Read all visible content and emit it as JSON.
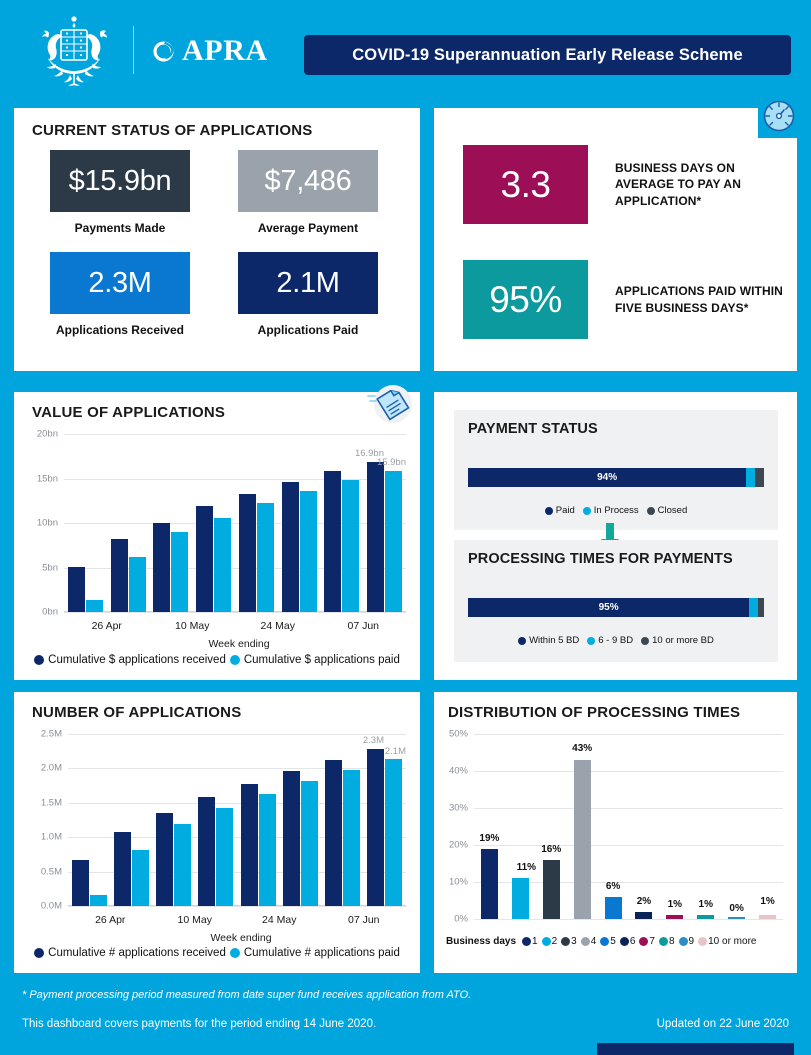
{
  "theme": {
    "page_bg": "#00a5de",
    "navy": "#0d2868",
    "dark_navy": "#0a2458",
    "light_blue": "#00ace0",
    "charcoal": "#2c3a47",
    "grey": "#9aa3ab",
    "blue": "#0a78d1",
    "magenta": "#9c0f57",
    "teal": "#0d9a9e",
    "panel_grey": "#f0f1f2"
  },
  "header": {
    "org_name": "APRA",
    "coat_of_arms_alt": "Australian Coat of Arms",
    "title": "COVID-19 Superannuation Early Release Scheme"
  },
  "status_card": {
    "title": "CURRENT STATUS OF APPLICATIONS",
    "kpis": [
      {
        "value": "$15.9bn",
        "caption": "Payments Made",
        "bg": "#2c3a47"
      },
      {
        "value": "$7,486",
        "caption": "Average Payment",
        "bg": "#9aa3ab"
      },
      {
        "value": "2.3M",
        "caption": "Applications Received",
        "bg": "#0a78d1"
      },
      {
        "value": "2.1M",
        "caption": "Applications Paid",
        "bg": "#0d2868"
      }
    ]
  },
  "timing_card": {
    "icon": "gauge-icon",
    "metrics": [
      {
        "value": "3.3",
        "label": "BUSINESS DAYS ON AVERAGE TO PAY AN APPLICATION*",
        "bg": "#9c0f57"
      },
      {
        "value": "95%",
        "label": "APPLICATIONS PAID WITHIN FIVE BUSINESS DAYS*",
        "bg": "#0d9a9e"
      }
    ]
  },
  "value_card": {
    "title": "VALUE OF APPLICATIONS",
    "icon": "document-icon"
  },
  "number_card": {
    "title": "NUMBER OF APPLICATIONS"
  },
  "payment_card": {
    "status": {
      "title": "PAYMENT STATUS",
      "segments": [
        {
          "label": "Paid",
          "value": 94,
          "display": "94%",
          "color": "#0d2868"
        },
        {
          "label": "In Process",
          "value": 3,
          "display": "",
          "color": "#00ace0"
        },
        {
          "label": "Closed",
          "value": 3,
          "display": "",
          "color": "#3d4852"
        }
      ]
    },
    "processing": {
      "title": "PROCESSING TIMES FOR PAYMENTS",
      "segments": [
        {
          "label": "Within 5 BD",
          "value": 95,
          "display": "95%",
          "color": "#0d2868"
        },
        {
          "label": "6 - 9 BD",
          "value": 3,
          "display": "",
          "color": "#00ace0"
        },
        {
          "label": "10 or more BD",
          "value": 2,
          "display": "",
          "color": "#3d4852"
        }
      ]
    }
  },
  "dist_card": {
    "title": "DISTRIBUTION OF PROCESSING TIMES",
    "legend_label": "Business days"
  },
  "footer": {
    "note": "* Payment processing period measured from date super fund receives application from ATO.",
    "coverage": "This dashboard covers payments for the period ending 14 June 2020.",
    "updated": "Updated on 22 June 2020"
  },
  "chart_data": [
    {
      "type": "bar",
      "id": "value_of_applications",
      "title": "VALUE OF APPLICATIONS",
      "xlabel": "Week ending",
      "ylabel": "",
      "ylim": [
        0,
        20
      ],
      "yticks": [
        "0bn",
        "5bn",
        "10bn",
        "15bn",
        "20bn"
      ],
      "ytick_values": [
        0,
        5,
        10,
        15,
        20
      ],
      "grid": true,
      "legend_position": "bottom",
      "categories": [
        "26 Apr",
        "",
        "10 May",
        "",
        "24 May",
        "",
        "07 Jun",
        ""
      ],
      "xtick_labels": [
        "26 Apr",
        "10 May",
        "24 May",
        "07 Jun"
      ],
      "series": [
        {
          "name": "Cumulative $ applications received",
          "color": "#0d2868",
          "values": [
            5.1,
            8.2,
            10.0,
            11.9,
            13.3,
            14.6,
            15.8,
            16.9
          ]
        },
        {
          "name": "Cumulative $ applications paid",
          "color": "#00ace0",
          "values": [
            1.3,
            6.2,
            9.0,
            10.6,
            12.3,
            13.6,
            14.8,
            15.9
          ]
        }
      ],
      "annotations": [
        {
          "text": "16.9bn",
          "series": "Cumulative $ applications received",
          "index": 7
        },
        {
          "text": "15.9bn",
          "series": "Cumulative $ applications paid",
          "index": 7
        }
      ]
    },
    {
      "type": "bar",
      "id": "number_of_applications",
      "title": "NUMBER OF APPLICATIONS",
      "xlabel": "Week ending",
      "ylabel": "",
      "ylim": [
        0,
        2.5
      ],
      "yticks": [
        "0.0M",
        "0.5M",
        "1.0M",
        "1.5M",
        "2.0M",
        "2.5M"
      ],
      "ytick_values": [
        0,
        0.5,
        1.0,
        1.5,
        2.0,
        2.5
      ],
      "grid": true,
      "legend_position": "bottom",
      "categories": [
        "26 Apr",
        "",
        "10 May",
        "",
        "24 May",
        "",
        "07 Jun",
        ""
      ],
      "xtick_labels": [
        "26 Apr",
        "10 May",
        "24 May",
        "07 Jun"
      ],
      "series": [
        {
          "name": "Cumulative # applications received",
          "color": "#0d2868",
          "values": [
            0.67,
            1.08,
            1.35,
            1.59,
            1.78,
            1.96,
            2.12,
            2.28
          ]
        },
        {
          "name": "Cumulative # applications paid",
          "color": "#00ace0",
          "values": [
            0.16,
            0.81,
            1.19,
            1.42,
            1.63,
            1.81,
            1.98,
            2.13
          ]
        }
      ],
      "annotations": [
        {
          "text": "2.3M",
          "series": "Cumulative # applications received",
          "index": 7
        },
        {
          "text": "2.1M",
          "series": "Cumulative # applications paid",
          "index": 7
        }
      ]
    },
    {
      "type": "bar",
      "id": "distribution_of_processing_times",
      "title": "DISTRIBUTION OF PROCESSING TIMES",
      "xlabel": "Business days",
      "ylabel": "",
      "ylim": [
        0,
        50
      ],
      "yticks": [
        "0%",
        "10%",
        "20%",
        "30%",
        "40%",
        "50%"
      ],
      "ytick_values": [
        0,
        10,
        20,
        30,
        40,
        50
      ],
      "grid": true,
      "legend_position": "bottom",
      "categories": [
        "1",
        "2",
        "3",
        "4",
        "5",
        "6",
        "7",
        "8",
        "9",
        "10 or more"
      ],
      "values": [
        19,
        11,
        16,
        43,
        6,
        2,
        1,
        1,
        0,
        1
      ],
      "data_labels": [
        "19%",
        "11%",
        "16%",
        "43%",
        "6%",
        "2%",
        "1%",
        "1%",
        "0%",
        "1%"
      ],
      "colors": [
        "#0d2868",
        "#00ace0",
        "#2c3a47",
        "#9aa3ab",
        "#0a78d1",
        "#0a2458",
        "#9c0f57",
        "#0d9a9e",
        "#2b8fc4",
        "#e8c4c9"
      ]
    },
    {
      "type": "bar",
      "id": "payment_status",
      "title": "PAYMENT STATUS",
      "orientation": "horizontal-stacked",
      "categories": [
        "Paid",
        "In Process",
        "Closed"
      ],
      "values": [
        94,
        3,
        3
      ],
      "data_labels": [
        "94%",
        "",
        ""
      ],
      "colors": [
        "#0d2868",
        "#00ace0",
        "#3d4852"
      ]
    },
    {
      "type": "bar",
      "id": "processing_times_for_payments",
      "title": "PROCESSING TIMES FOR PAYMENTS",
      "orientation": "horizontal-stacked",
      "categories": [
        "Within 5 BD",
        "6 - 9 BD",
        "10 or more BD"
      ],
      "values": [
        95,
        3,
        2
      ],
      "data_labels": [
        "95%",
        "",
        ""
      ],
      "colors": [
        "#0d2868",
        "#00ace0",
        "#3d4852"
      ]
    }
  ]
}
